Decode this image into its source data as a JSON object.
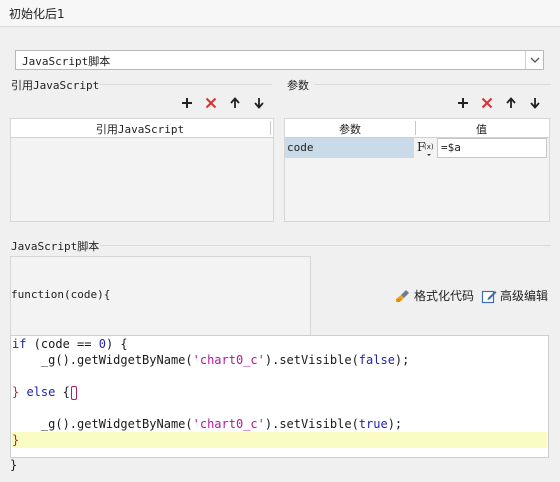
{
  "window": {
    "title": "初始化后1"
  },
  "script_type": {
    "selected": "JavaScript脚本"
  },
  "referenced_js": {
    "section_label": "引用JavaScript",
    "column_header": "引用JavaScript",
    "toolbar": [
      "add-icon",
      "delete-icon",
      "move-up-icon",
      "move-down-icon"
    ]
  },
  "params": {
    "section_label": "参数",
    "columns": [
      "参数",
      "值"
    ],
    "rows": [
      {
        "name": "code",
        "value": "=$a"
      }
    ],
    "toolbar": [
      "add-icon",
      "delete-icon",
      "move-up-icon",
      "move-down-icon"
    ]
  },
  "script": {
    "section_label": "JavaScript脚本",
    "header": "function(code){",
    "footer": "}",
    "format_label": "格式化代码",
    "advanced_label": "高级编辑",
    "code": {
      "l1_kw": "if",
      "l1_a": " (code == ",
      "l1_num": "0",
      "l1_b": ") {",
      "l2_a": "    _g().getWidgetByName(",
      "l2_str": "'chart0_c'",
      "l2_b": ").setVisible(",
      "l2_kw": "false",
      "l2_c": ");",
      "l4_a": "} ",
      "l4_kw": "else",
      "l4_b": " {",
      "l6_a": "    _g().getWidgetByName(",
      "l6_str": "'chart0_c'",
      "l6_b": ").setVisible(",
      "l6_kw": "true",
      "l6_c": ");",
      "l7": "}"
    }
  },
  "colors": {
    "accent_red": "#d63232",
    "highlight_line": "#fbfbc4",
    "selected_row": "#c9dbe8"
  }
}
